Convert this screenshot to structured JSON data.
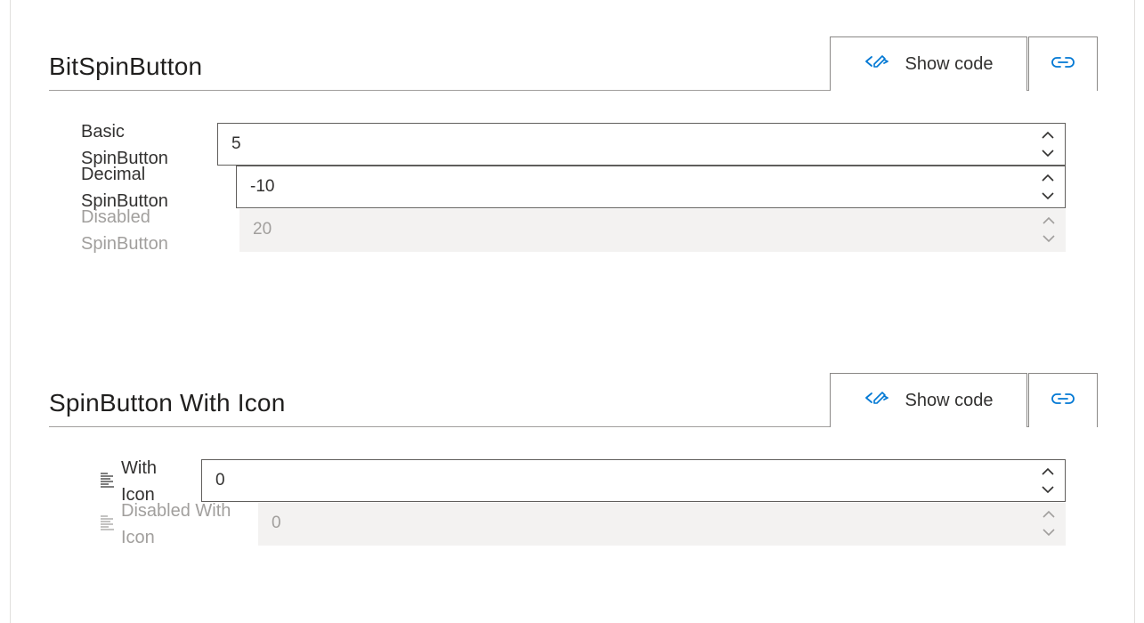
{
  "sections": [
    {
      "title": "BitSpinButton",
      "show_code_label": "Show code",
      "rows": [
        {
          "label_line1": "Basic",
          "label_line2": "SpinButton",
          "value": "5",
          "disabled": false
        },
        {
          "label_line1": "Decimal",
          "label_line2": "SpinButton",
          "value": "-10",
          "disabled": false
        },
        {
          "label_line1": "Disabled",
          "label_line2": "SpinButton",
          "value": "20",
          "disabled": true
        }
      ]
    },
    {
      "title": "SpinButton With Icon",
      "show_code_label": "Show code",
      "rows": [
        {
          "label_line1": "With",
          "label_line2": "Icon",
          "value": "0",
          "disabled": false,
          "icon": "text-align-icon"
        },
        {
          "label_line1": "Disabled With",
          "label_line2": "Icon",
          "value": "0",
          "disabled": true,
          "icon": "text-align-icon"
        }
      ]
    }
  ],
  "colors": {
    "accent": "#0078d4",
    "border": "#605e5c",
    "disabled_bg": "#f3f2f1",
    "disabled_text": "#a19f9d"
  }
}
